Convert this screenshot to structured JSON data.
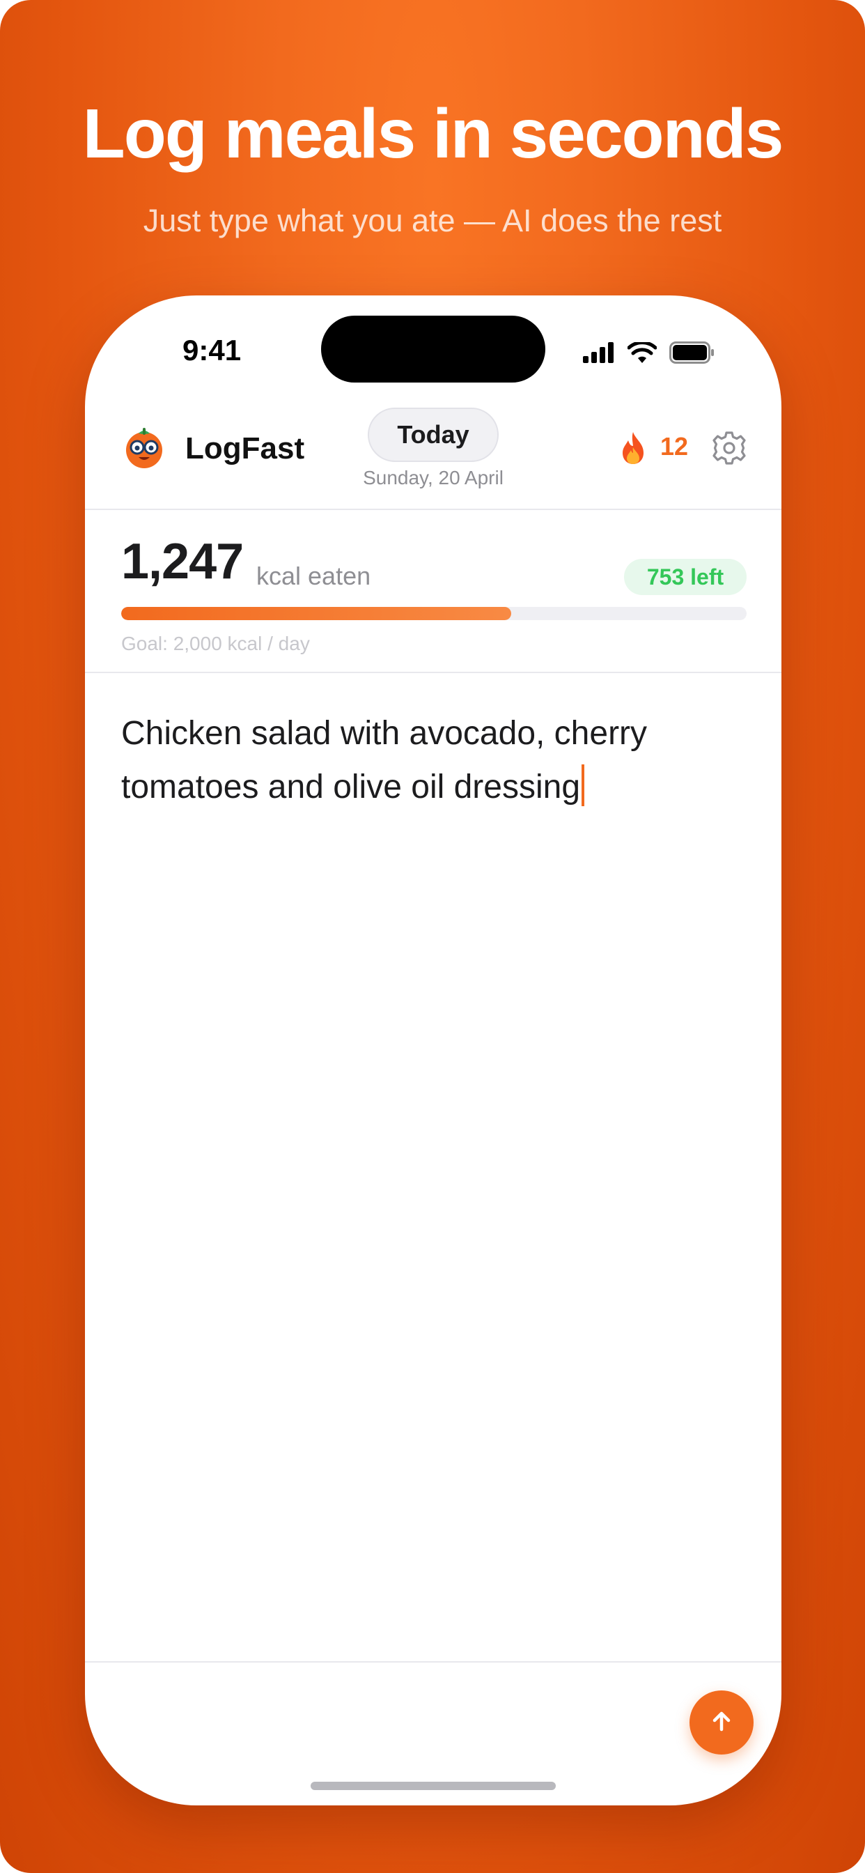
{
  "promo": {
    "headline": "Log meals in seconds",
    "subheadline": "Just type what you ate — AI does the rest"
  },
  "status_bar": {
    "time": "9:41",
    "icons": [
      "cellular-signal-icon",
      "wifi-icon",
      "battery-icon"
    ]
  },
  "header": {
    "app_name": "LogFast",
    "logo_icon": "tomato-mascot-icon",
    "today_label": "Today",
    "date": "Sunday, 20 April",
    "streak_icon": "flame-icon",
    "streak_count": "12",
    "settings_icon": "gear-icon"
  },
  "summary": {
    "kcal_eaten": "1,247",
    "kcal_unit": "kcal eaten",
    "left_badge": "753 left",
    "progress_fraction": 0.6235,
    "goal_label": "Goal: 2,000 kcal / day"
  },
  "input": {
    "text": "Chicken salad with avocado, cherry tomatoes and olive oil dressing"
  },
  "send_button": {
    "icon": "arrow-up-icon"
  },
  "colors": {
    "brand": "#f26a1e",
    "background_gradient": [
      "#f97424",
      "#cf4405"
    ],
    "positive": "#34c759",
    "positive_bg": "#e7f8ec",
    "muted_text": "#8e8e93"
  }
}
